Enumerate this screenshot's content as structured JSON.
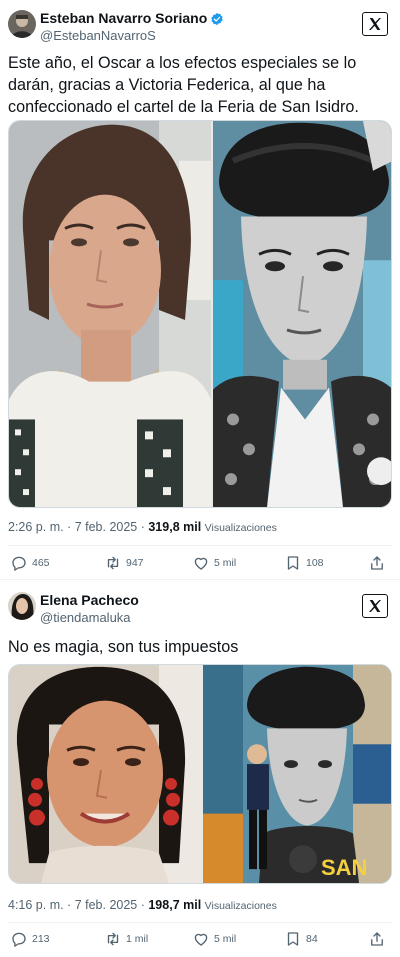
{
  "tweets": [
    {
      "display_name": "Esteban Navarro Soriano",
      "handle": "@EstebanNavarroS",
      "text": "Este año, el Oscar a los efectos especiales se lo darán, gracias a Victoria Federica, al que ha confeccionado el cartel de la Feria de San Isidro.",
      "time": "2:26 p. m. · 7 feb. 2025 · ",
      "views_count": "319,8 mil",
      "views_label": "Visualizaciones",
      "replies": "465",
      "reposts": "947",
      "likes": "5 mil",
      "bookmarks": "108",
      "verified": true
    },
    {
      "display_name": "Elena Pacheco",
      "handle": "@tiendamaluka",
      "text": "No es magia, son tus impuestos",
      "time": "4:16 p. m. · 7 feb. 2025 · ",
      "views_count": "198,7 mil",
      "views_label": "Visualizaciones",
      "replies": "213",
      "reposts": "1 mil",
      "likes": "5 mil",
      "bookmarks": "84",
      "verified": false,
      "poster_text": "SAN"
    }
  ],
  "icons": {
    "brand": "x-logo-icon",
    "verified": "verified-badge-icon",
    "reply": "reply-icon",
    "repost": "repost-icon",
    "like": "like-icon",
    "bookmark": "bookmark-icon",
    "share": "share-icon"
  },
  "colors": {
    "verified_blue": "#1d9bf0",
    "text_primary": "#0f1419",
    "text_secondary": "#536471"
  }
}
